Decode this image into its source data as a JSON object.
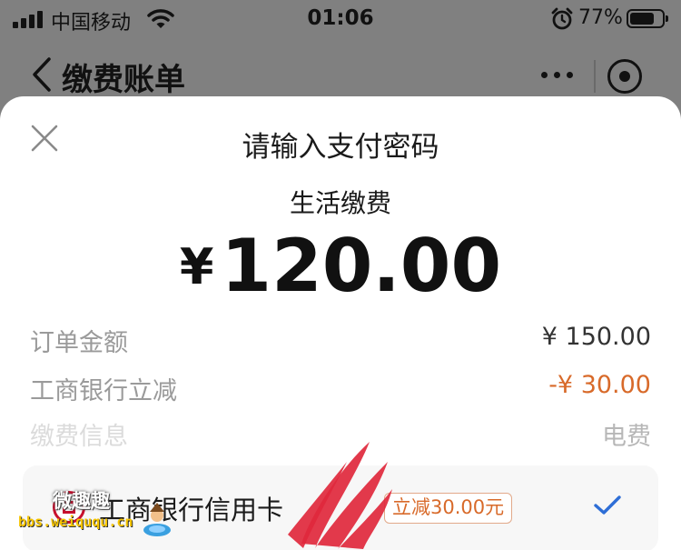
{
  "status_bar": {
    "carrier": "中国移动",
    "time": "01:06",
    "battery_percent": "77%"
  },
  "nav": {
    "back_icon": "chevron-left-icon",
    "title": "缴费账单",
    "more_icon": "more-dots-icon",
    "close_icon": "target-circle-icon"
  },
  "sheet": {
    "title": "请输入支付密码",
    "subtitle": "生活缴费",
    "amount_currency": "¥",
    "amount_value": "120.00",
    "rows": [
      {
        "label": "订单金额",
        "value": "¥ 150.00"
      },
      {
        "label": "工商银行立减",
        "value": "-¥ 30.00"
      },
      {
        "label": "缴费信息",
        "value": "电费"
      }
    ],
    "payment_method": {
      "name": "工商银行信用卡",
      "promo": "立减30.00元",
      "selected": true
    }
  },
  "watermark": {
    "logo_text": "微趣趣",
    "url": "bbs.weiququ.cn"
  },
  "colors": {
    "accent_orange": "#d86a2a",
    "check_blue": "#2e6ed6",
    "icbc_red": "#c8102e",
    "scribble_red": "#e0283c"
  }
}
